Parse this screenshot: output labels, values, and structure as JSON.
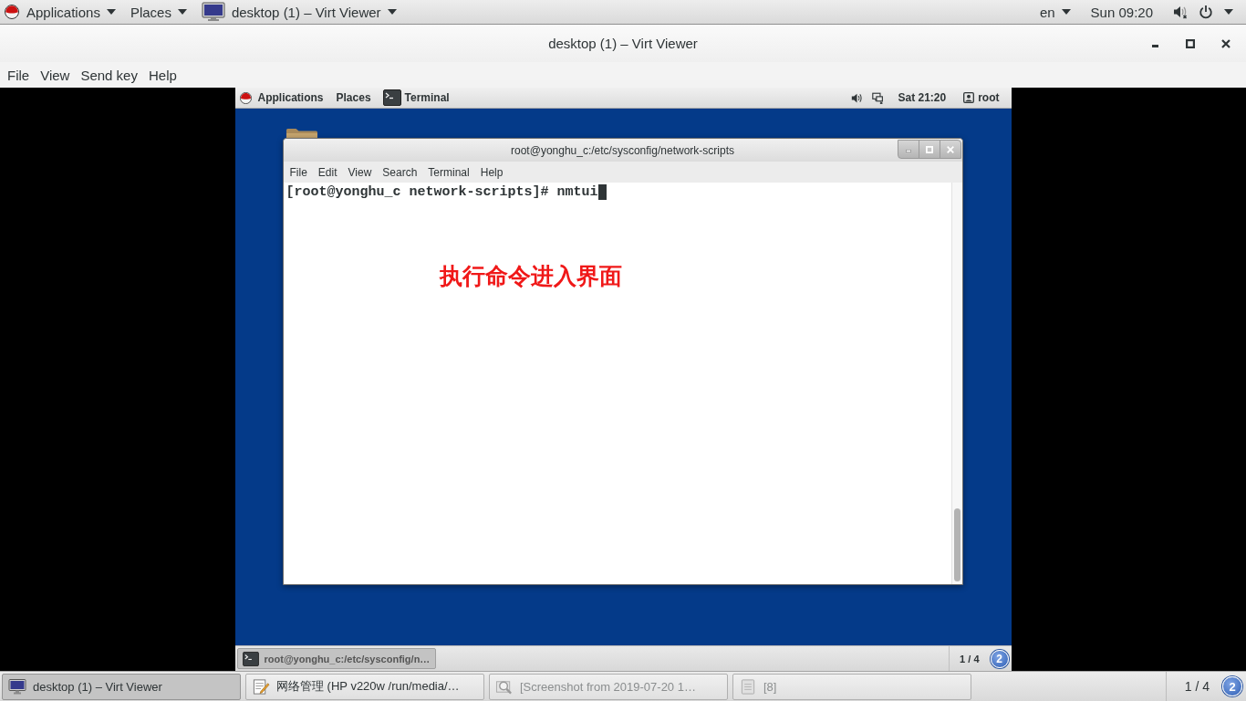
{
  "top_bar": {
    "menus": [
      "Applications",
      "Places"
    ],
    "app_menu": "desktop (1) – Virt Viewer",
    "keyboard": "en",
    "clock": "Sun 09:20"
  },
  "window": {
    "title": "desktop (1) – Virt Viewer"
  },
  "menu_bar": [
    "File",
    "View",
    "Send key",
    "Help"
  ],
  "guest": {
    "top_bar": {
      "menus": [
        "Applications",
        "Places"
      ],
      "app_menu": "Terminal",
      "clock": "Sat 21:20",
      "user": "root"
    },
    "terminal": {
      "title": "root@yonghu_c:/etc/sysconfig/network-scripts",
      "menu": [
        "File",
        "Edit",
        "View",
        "Search",
        "Terminal",
        "Help"
      ],
      "lines": [
        "[root@yonghu_c network-scripts]# nmtui"
      ]
    },
    "annotation": "执行命令进入界面",
    "taskbar": {
      "tasks": [
        {
          "label": "root@yonghu_c:/etc/sysconfig/n…",
          "selected": true
        }
      ],
      "workspace": "1 / 4",
      "messages": "2"
    }
  },
  "taskbar": {
    "tasks": [
      {
        "kind": "viewer",
        "label": "desktop (1) – Virt Viewer",
        "selected": true,
        "minimized": false
      },
      {
        "kind": "editor",
        "label": "网络管理 (HP v220w /run/media/…",
        "selected": false,
        "minimized": false
      },
      {
        "kind": "screenshot",
        "label": "[Screenshot from 2019-07-20 1…",
        "selected": false,
        "minimized": true
      },
      {
        "kind": "document",
        "label": "[8]",
        "selected": false,
        "minimized": true
      }
    ],
    "workspace": "1 / 4",
    "messages": "2"
  }
}
